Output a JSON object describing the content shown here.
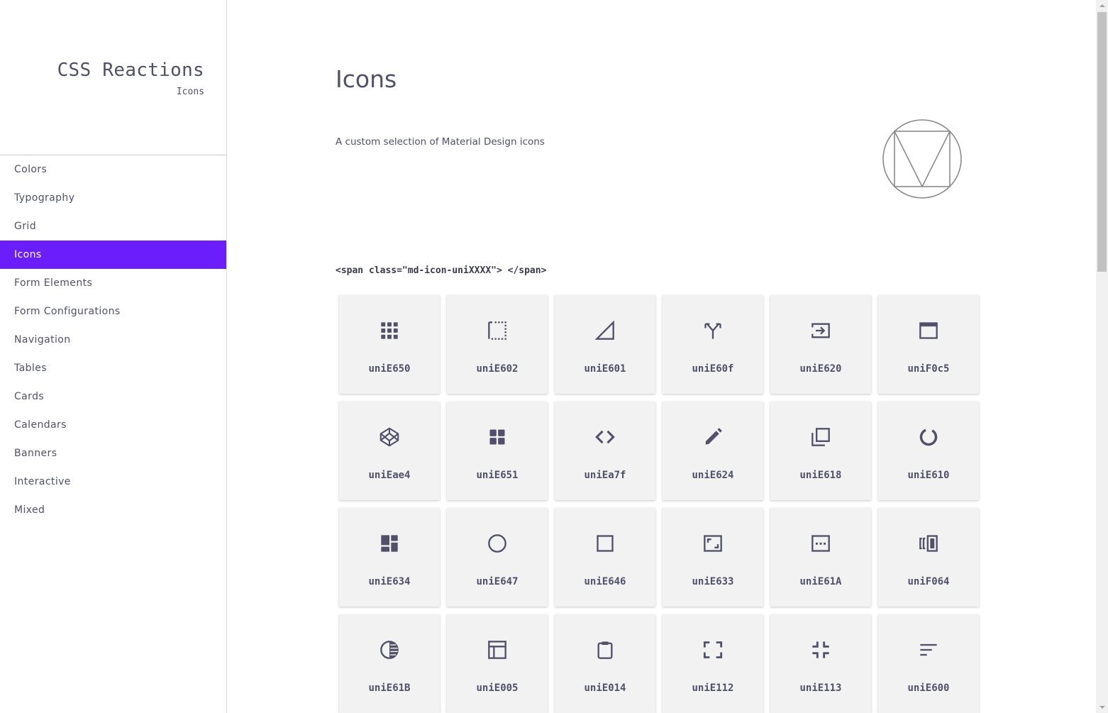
{
  "brand": {
    "title": "CSS Reactions",
    "subtitle": "Icons"
  },
  "nav": {
    "items": [
      {
        "label": "Colors"
      },
      {
        "label": "Typography"
      },
      {
        "label": "Grid"
      },
      {
        "label": "Icons",
        "active": true
      },
      {
        "label": "Form Elements"
      },
      {
        "label": "Form Configurations"
      },
      {
        "label": "Navigation"
      },
      {
        "label": "Tables"
      },
      {
        "label": "Cards"
      },
      {
        "label": "Calendars"
      },
      {
        "label": "Banners"
      },
      {
        "label": "Interactive"
      },
      {
        "label": "Mixed"
      }
    ]
  },
  "main": {
    "title": "Icons",
    "description": "A custom selection of Material Design icons",
    "code_sample": "<span class=\"md-icon-uniXXXX\"> </span>",
    "logo_icon": "material-design-logo-icon"
  },
  "icons": [
    {
      "code": "uniE650",
      "icon": "apps-grid-icon"
    },
    {
      "code": "uniE602",
      "icon": "border-dotted-icon"
    },
    {
      "code": "uniE601",
      "icon": "signal-triangle-icon"
    },
    {
      "code": "uniE60f",
      "icon": "merge-arrows-icon"
    },
    {
      "code": "uniE620",
      "icon": "input-arrow-icon"
    },
    {
      "code": "uniF0c5",
      "icon": "browser-window-icon"
    },
    {
      "code": "uniEae4",
      "icon": "codepen-cube-icon"
    },
    {
      "code": "uniE651",
      "icon": "grid-squares-icon"
    },
    {
      "code": "uniEa7f",
      "icon": "code-brackets-icon"
    },
    {
      "code": "uniE624",
      "icon": "pencil-icon"
    },
    {
      "code": "uniE618",
      "icon": "copy-layers-icon"
    },
    {
      "code": "uniE610",
      "icon": "loading-ring-icon"
    },
    {
      "code": "uniE634",
      "icon": "dashboard-icon"
    },
    {
      "code": "uniE647",
      "icon": "circle-outline-icon"
    },
    {
      "code": "uniE646",
      "icon": "square-outline-icon"
    },
    {
      "code": "uniE633",
      "icon": "aspect-ratio-icon"
    },
    {
      "code": "uniE61A",
      "icon": "dots-box-icon"
    },
    {
      "code": "uniF064",
      "icon": "carousel-icon"
    },
    {
      "code": "uniE61B",
      "icon": "contrast-icon"
    },
    {
      "code": "uniE005",
      "icon": "layout-panel-icon"
    },
    {
      "code": "uniE014",
      "icon": "clipboard-icon"
    },
    {
      "code": "uniE112",
      "icon": "fullscreen-icon"
    },
    {
      "code": "uniE113",
      "icon": "fullscreen-exit-icon"
    },
    {
      "code": "uniE600",
      "icon": "sort-lines-icon"
    }
  ],
  "colors": {
    "accent": "#6c1dfc",
    "text": "#50506a",
    "card_bg": "#f2f2f2"
  }
}
